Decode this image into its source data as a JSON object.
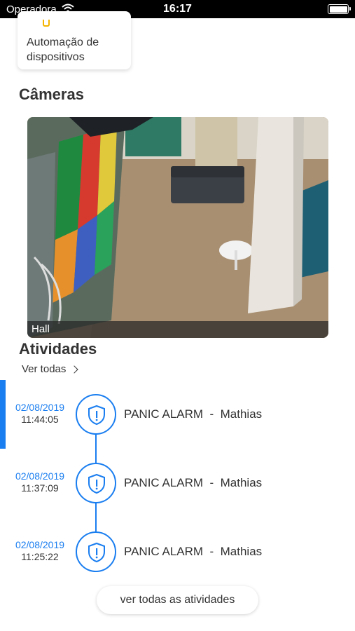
{
  "status_bar": {
    "carrier": "Operadora",
    "time": "16:17"
  },
  "device_card": {
    "label": "Automação de dispositivos"
  },
  "cameras": {
    "title": "Câmeras",
    "feed": {
      "caption": "Hall"
    }
  },
  "activities": {
    "title": "Atividades",
    "see_all_label": "Ver todas",
    "accent_color": "#1a7ef0",
    "items": [
      {
        "date": "02/08/2019",
        "time": "11:44:05",
        "event": "PANIC ALARM",
        "user": "Mathias",
        "icon": "shield-alert-icon"
      },
      {
        "date": "02/08/2019",
        "time": "11:37:09",
        "event": "PANIC ALARM",
        "user": "Mathias",
        "icon": "shield-alert-icon"
      },
      {
        "date": "02/08/2019",
        "time": "11:25:22",
        "event": "PANIC ALARM",
        "user": "Mathias",
        "icon": "shield-alert-icon"
      }
    ],
    "view_all_button": "ver todas as atividades"
  }
}
